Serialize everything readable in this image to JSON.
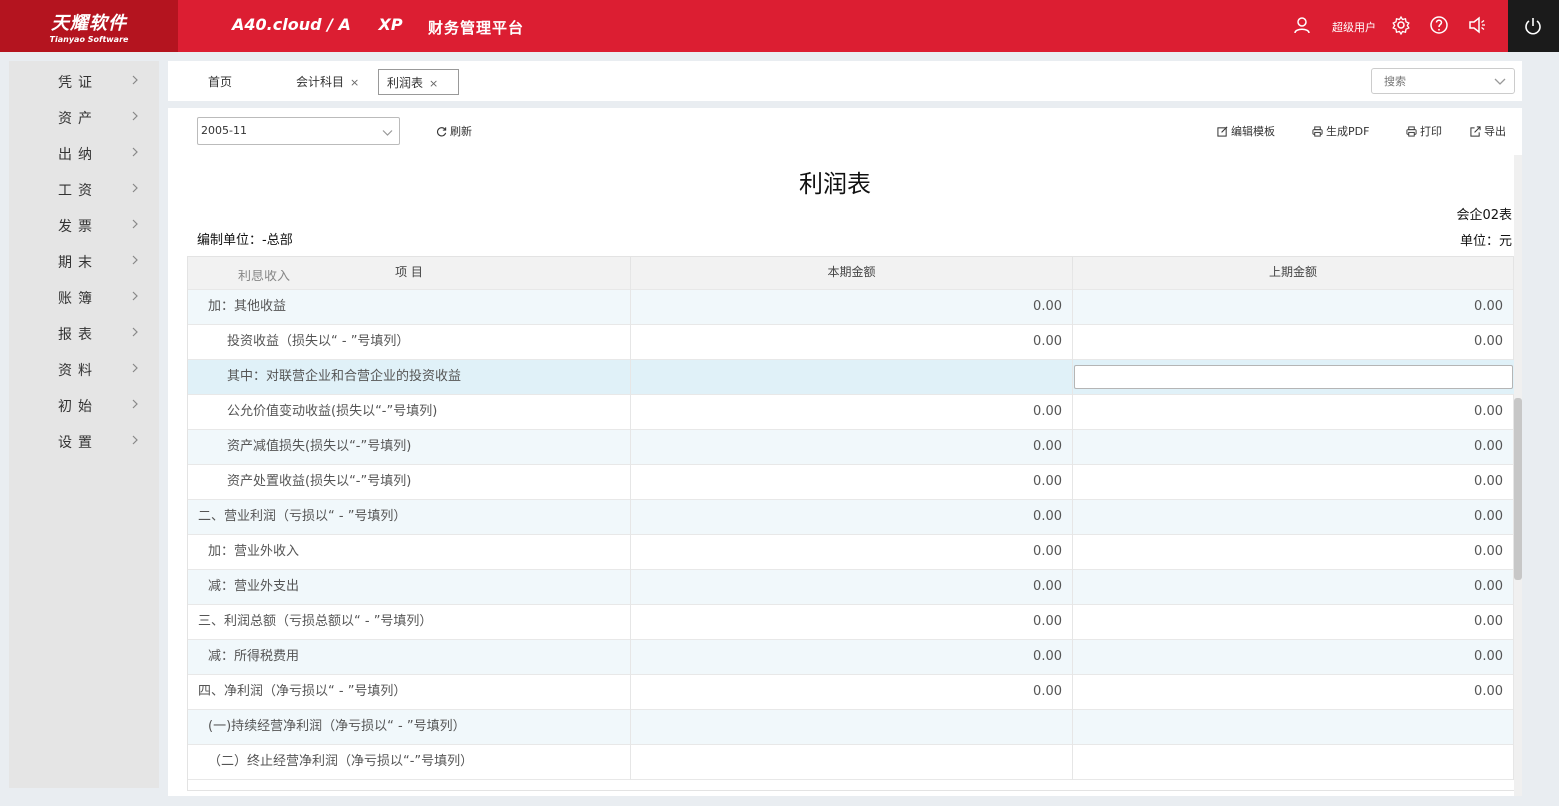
{
  "header": {
    "logo_cn": "天耀软件",
    "logo_en": "Tianyao Software",
    "product": "A40.cloud / A XP",
    "product_main": "A40.cloud / A",
    "product_suffix": "XP",
    "platform": "财务管理平台",
    "user_name": "超级用户",
    "icons": [
      "user-icon",
      "gear-icon",
      "help-icon",
      "volume-icon",
      "power-icon"
    ],
    "colors": {
      "bar": "#dc1e32",
      "logo_bg": "#b4141f",
      "power_bg": "#1b1b1b"
    }
  },
  "sidebar": {
    "items": [
      {
        "label": "凭证"
      },
      {
        "label": "资产"
      },
      {
        "label": "出纳"
      },
      {
        "label": "工资"
      },
      {
        "label": "发票"
      },
      {
        "label": "期末"
      },
      {
        "label": "账簿"
      },
      {
        "label": "报表"
      },
      {
        "label": "资料"
      },
      {
        "label": "初始"
      },
      {
        "label": "设置"
      }
    ]
  },
  "tabs": {
    "items": [
      {
        "label": "首页",
        "closable": false
      },
      {
        "label": "会计科目",
        "closable": true
      },
      {
        "label": "利润表",
        "closable": true,
        "active": true
      }
    ],
    "close_glyph": "×",
    "search_placeholder": "搜索"
  },
  "toolbar": {
    "period_value": "2005-11",
    "refresh": "刷新",
    "edit_template": "编辑模板",
    "generate_pdf": "生成PDF",
    "print": "打印",
    "export": "导出"
  },
  "report": {
    "title": "利润表",
    "form_no": "会企02表",
    "org_label": "编制单位：-总部",
    "unit_label": "单位：元"
  },
  "table": {
    "columns": [
      "项 目",
      "本期金额",
      "上期金额"
    ],
    "partial_top_row": "利息收入",
    "rows": [
      {
        "item": "加：其他收益",
        "current": "0.00",
        "previous": "0.00",
        "indent": 1
      },
      {
        "item": "投资收益（损失以“ - ”号填列）",
        "current": "0.00",
        "previous": "0.00",
        "indent": 2
      },
      {
        "item": "其中：对联营企业和合营企业的投资收益",
        "current": "",
        "previous": "",
        "indent": 2,
        "editing": true
      },
      {
        "item": "公允价值变动收益(损失以“-”号填列)",
        "current": "0.00",
        "previous": "0.00",
        "indent": 2
      },
      {
        "item": "资产减值损失(损失以“-”号填列)",
        "current": "0.00",
        "previous": "0.00",
        "indent": 2
      },
      {
        "item": "资产处置收益(损失以“-”号填列)",
        "current": "0.00",
        "previous": "0.00",
        "indent": 2
      },
      {
        "item": "二、营业利润（亏损以“ - ”号填列）",
        "current": "0.00",
        "previous": "0.00",
        "indent": 0
      },
      {
        "item": "加：营业外收入",
        "current": "0.00",
        "previous": "0.00",
        "indent": 1
      },
      {
        "item": "减：营业外支出",
        "current": "0.00",
        "previous": "0.00",
        "indent": 1
      },
      {
        "item": "三、利润总额（亏损总额以“ - ”号填列）",
        "current": "0.00",
        "previous": "0.00",
        "indent": 0
      },
      {
        "item": "减：所得税费用",
        "current": "0.00",
        "previous": "0.00",
        "indent": 1
      },
      {
        "item": "四、净利润（净亏损以“ - ”号填列）",
        "current": "0.00",
        "previous": "0.00",
        "indent": 0
      },
      {
        "item": "(一)持续经营净利润（净亏损以“ - ”号填列）",
        "current": "",
        "previous": "",
        "indent": 1
      },
      {
        "item": "（二）终止经营净利润（净亏损以“-”号填列）",
        "current": "",
        "previous": "",
        "indent": 1
      }
    ]
  }
}
